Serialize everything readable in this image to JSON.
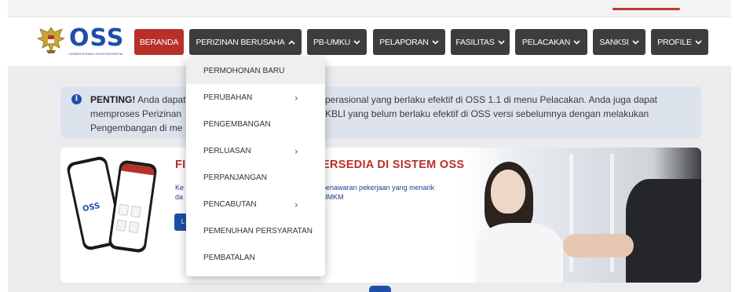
{
  "nav": {
    "brand": "OSS",
    "brand_sub": "KEMENTERIAN INVESTASI/BKPM",
    "items": [
      {
        "label": "BERANDA",
        "dropdown": false,
        "active": true
      },
      {
        "label": "PERIZINAN BERUSAHA",
        "dropdown": true,
        "expanded": true
      },
      {
        "label": "PB-UMKU",
        "dropdown": true
      },
      {
        "label": "PELAPORAN",
        "dropdown": true
      },
      {
        "label": "FASILITAS",
        "dropdown": true
      },
      {
        "label": "PELACAKAN",
        "dropdown": true
      },
      {
        "label": "SANKSI",
        "dropdown": true
      },
      {
        "label": "PROFILE",
        "dropdown": true
      }
    ]
  },
  "dropdown": {
    "items": [
      {
        "label": "PERMOHONAN BARU",
        "submenu": false,
        "hovered": true
      },
      {
        "label": "PERUBAHAN",
        "submenu": true
      },
      {
        "label": "PENGEMBANGAN",
        "submenu": false
      },
      {
        "label": "PERLUASAN",
        "submenu": true
      },
      {
        "label": "PERPANJANGAN",
        "submenu": false
      },
      {
        "label": "PENCABUTAN",
        "submenu": true
      },
      {
        "label": "PEMENUHAN PERSYARATAN",
        "submenu": false
      },
      {
        "label": "PEMBATALAN",
        "submenu": false
      }
    ]
  },
  "alert": {
    "strong": "PENTING!",
    "line1_a": " Anda dapat",
    "line1_b": "perasional yang berlaku efektif di OSS 1.1 di menu Pelacakan. Anda juga dapat",
    "line2_a": "memproses Perizinan",
    "line2_b": "KBLI yang belum berlaku efektif di OSS versi sebelumnya dengan melakukan",
    "line3_a": "Pengembangan di me"
  },
  "banner": {
    "title_a": "FI",
    "title_b": "ERSEDIA DI SISTEM OSS",
    "sub1_a": "Ke",
    "sub1_b": "penawaran pekerjaan yang menarik",
    "sub2_a": "da",
    "sub2_b": "UMKM",
    "button_fragment": "L",
    "phone_brand": "OSS"
  },
  "colors": {
    "brand_blue": "#1f4ea8",
    "brand_red": "#b8302a",
    "nav_dark": "#3d3d3d",
    "alert_bg": "#dde3ec"
  }
}
